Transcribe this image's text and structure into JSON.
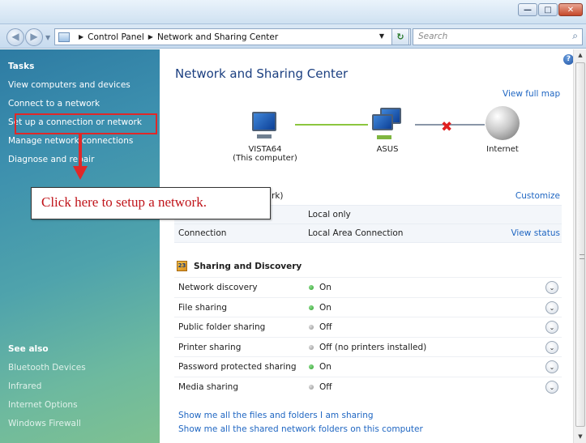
{
  "window": {
    "controls": {
      "minimize": "—",
      "maximize": "□",
      "close": "✕"
    }
  },
  "address_bar": {
    "crumbs": [
      "Control Panel",
      "Network and Sharing Center"
    ],
    "search_placeholder": "Search"
  },
  "sidebar": {
    "tasks_header": "Tasks",
    "tasks": [
      "View computers and devices",
      "Connect to a network",
      "Set up a connection or network",
      "Manage network connections",
      "Diagnose and repair"
    ],
    "see_also_header": "See also",
    "see_also": [
      "Bluetooth Devices",
      "Infrared",
      "Internet Options",
      "Windows Firewall"
    ]
  },
  "main": {
    "title": "Network and Sharing Center",
    "view_full_map": "View full map",
    "map": {
      "nodes": [
        {
          "label": "VISTA64",
          "sublabel": "(This computer)",
          "icon": "computer-icon"
        },
        {
          "label": "ASUS",
          "sublabel": "",
          "icon": "network-computers-icon"
        },
        {
          "label": "Internet",
          "sublabel": "",
          "icon": "globe-icon"
        }
      ],
      "link1_color": "#8cc63f",
      "link2_color": "#8a96a8",
      "broken_link_icon": "red-x-icon"
    },
    "network": {
      "name_partial": "rk)",
      "customize": "Customize",
      "rows": [
        {
          "key": "",
          "value": "Local only",
          "action": ""
        },
        {
          "key": "Connection",
          "value": "Local Area Connection",
          "action": "View status"
        }
      ]
    },
    "sharing": {
      "header": "Sharing and Discovery",
      "rows": [
        {
          "label": "Network discovery",
          "status": "On",
          "on": true
        },
        {
          "label": "File sharing",
          "status": "On",
          "on": true
        },
        {
          "label": "Public folder sharing",
          "status": "Off",
          "on": false
        },
        {
          "label": "Printer sharing",
          "status": "Off (no printers installed)",
          "on": false
        },
        {
          "label": "Password protected sharing",
          "status": "On",
          "on": true
        },
        {
          "label": "Media sharing",
          "status": "Off",
          "on": false
        }
      ]
    },
    "links": [
      "Show me all the files and folders I am sharing",
      "Show me all the shared network folders on this computer"
    ]
  },
  "annotation": {
    "callout_text": "Click here to setup a network.",
    "color": "#e02828"
  }
}
